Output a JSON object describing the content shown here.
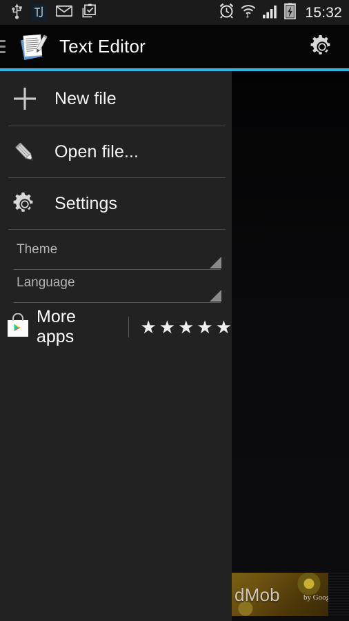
{
  "status_bar": {
    "icons_left": [
      "usb-icon",
      "tj-app-icon",
      "email-icon",
      "clipboard-check-icon"
    ],
    "icons_right": [
      "alarm-icon",
      "wifi-icon",
      "signal-icon",
      "battery-charging-icon"
    ],
    "clock": "15:32",
    "tj_badge_text": "Tj"
  },
  "action_bar": {
    "menu_icon": "hamburger-menu-icon",
    "app_icon": "text-editor-document-icon",
    "title": "Text Editor",
    "settings_icon": "gear-icon"
  },
  "colors": {
    "accent": "#33b5e5",
    "drawer_bg": "#222222",
    "content_bg": "#0a0a0c",
    "status_bg": "#1b1b1b",
    "divider": "#4a4a4a"
  },
  "drawer": {
    "items": [
      {
        "label": "New file",
        "icon": "plus-icon"
      },
      {
        "label": "Open file...",
        "icon": "pencil-icon"
      },
      {
        "label": "Settings",
        "icon": "gear-icon"
      }
    ],
    "spinners": [
      {
        "label": "Theme"
      },
      {
        "label": "Language"
      }
    ],
    "more_apps": {
      "label": "More apps",
      "icon": "google-play-store-icon",
      "stars": "★★★★★",
      "star_count": 5
    }
  },
  "ad": {
    "label": "dMob",
    "sublabel": "by Google"
  }
}
